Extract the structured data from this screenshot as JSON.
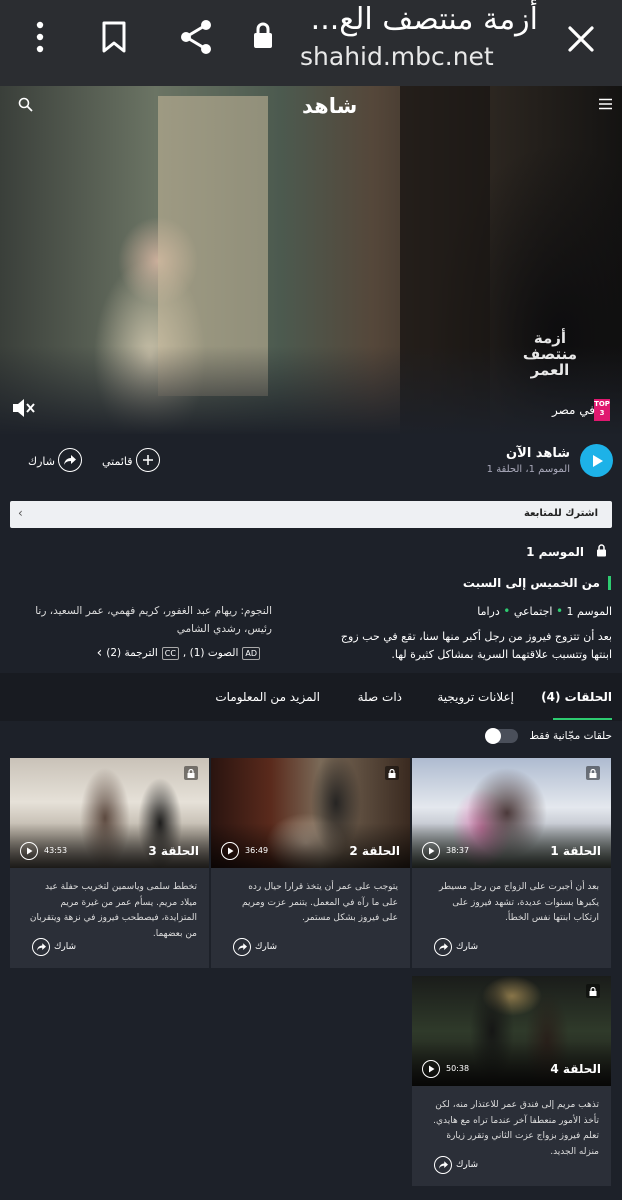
{
  "browser": {
    "title": "أزمة منتصف الع...",
    "url": "shahid.mbc.net"
  },
  "site": {
    "logo": "شاهد"
  },
  "hero": {
    "show_logo_text": "أزمة منتصف العمر",
    "top_badge": "TOP 3",
    "region_label": "في مصر"
  },
  "actions": {
    "watch_now": "شاهد الآن",
    "watch_sub": "الموسم 1، الحلقة 1",
    "my_list": "قائمتي",
    "share": "شارك"
  },
  "subscribe": {
    "label": "اشترك للمتابعة"
  },
  "details": {
    "season": "الموسم 1",
    "schedule": "من الخميس إلى السبت",
    "meta_season": "الموسم 1",
    "genre1": "اجتماعي",
    "genre2": "دراما",
    "description": "بعد أن تتزوج فيروز من رجل أكبر منها سنا، تقع في حب زوج ابنتها وتتسبب علاقتهما السرية بمشاكل كثيرة لها.",
    "stars": "النجوم: ريهام عبد الغفور، كريم فهمي، عمر السعيد، رنا رئيس، رشدي الشامي",
    "audio": "الصوت (1) ,",
    "audio_tag": "AD",
    "subs": "الترجمة (2)",
    "subs_tag": "CC"
  },
  "tabs": {
    "episodes": "الحلقات (4)",
    "promos": "إعلانات ترويجية",
    "related": "ذات صلة",
    "more": "المزيد من المعلومات"
  },
  "filter": {
    "free_only": "حلقات مجّانية فقط"
  },
  "episodes": [
    {
      "title": "الحلقة 1",
      "duration": "38:37",
      "description": "بعد أن أجبرت على الزواج من رجل مسيطر يكبرها بسنوات عديدة، تشهد فيروز على ارتكاب ابنتها نفس الخطأ.",
      "share": "شارك"
    },
    {
      "title": "الحلقة 2",
      "duration": "36:49",
      "description": "يتوجب على عمر أن يتخذ قرارا حيال رده على ما رآه في المعمل. يتنمر عزت ومريم على فيروز بشكل مستمر.",
      "share": "شارك"
    },
    {
      "title": "الحلقة 3",
      "duration": "43:53",
      "description": "تخطط سلمى وياسمين لتخريب حفلة عيد ميلاد مريم. يسأم عمر من غيرة مريم المتزايدة، فيصطحب فيروز في نزهة ويتقربان من بعضهما.",
      "share": "شارك"
    },
    {
      "title": "الحلقة 4",
      "duration": "50:38",
      "description": "تذهب مريم إلى فندق عمر للاعتذار منه، لكن تأخذ الأمور منعطفا آخر عندما تراه مع هايدي. تعلم فيروز بزواج عزت الثاني وتقرر زيارة منزله الجديد.",
      "share": "شارك"
    }
  ],
  "colors": {
    "background": "#1d2129",
    "accent_green": "#2ecc71",
    "play_blue": "#1db2e8",
    "top_badge_pink": "#e0186f"
  }
}
